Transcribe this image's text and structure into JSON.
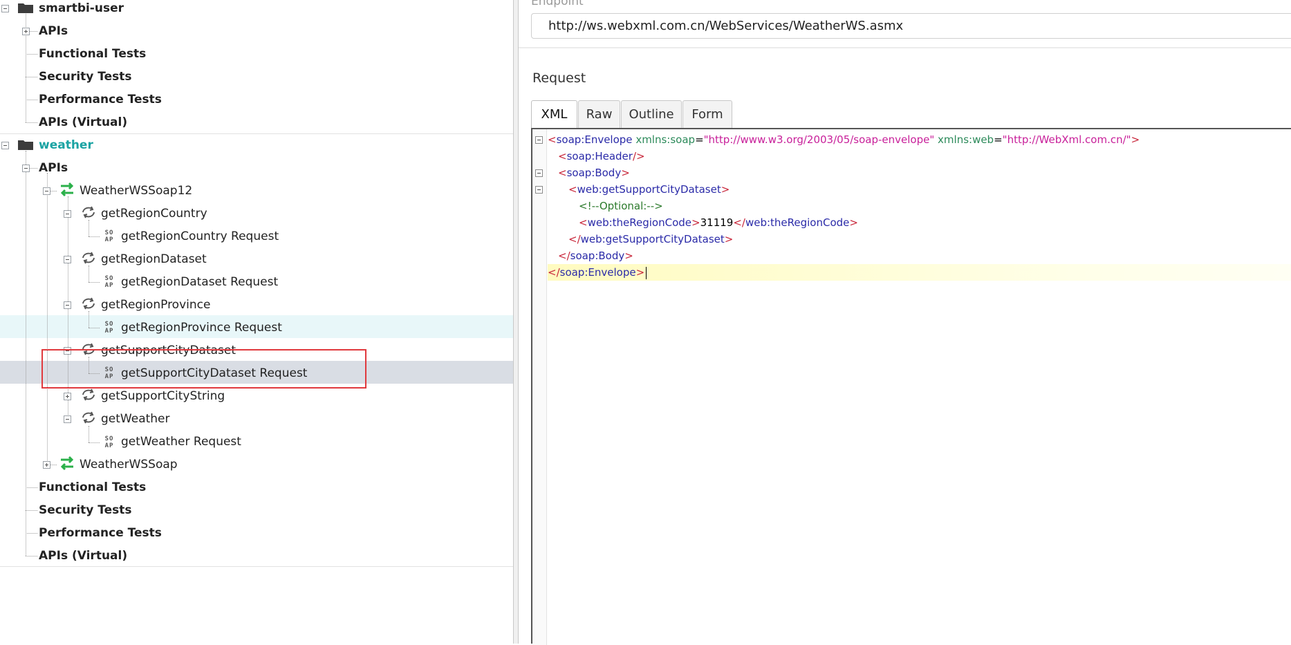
{
  "tree": {
    "projects": [
      {
        "name": "smartbi-user",
        "children": [
          "APIs",
          "Functional Tests",
          "Security Tests",
          "Performance Tests",
          "APIs (Virtual)"
        ]
      },
      {
        "name": "weather",
        "apis_label": "APIs",
        "interfaces": [
          {
            "name": "WeatherWSSoap12",
            "operations": [
              {
                "name": "getRegionCountry",
                "request": "getRegionCountry Request"
              },
              {
                "name": "getRegionDataset",
                "request": "getRegionDataset Request"
              },
              {
                "name": "getRegionProvince",
                "request": "getRegionProvince Request"
              },
              {
                "name": "getSupportCityDataset",
                "request": "getSupportCityDataset Request"
              },
              {
                "name": "getSupportCityString",
                "request": ""
              },
              {
                "name": "getWeather",
                "request": "getWeather Request"
              }
            ]
          },
          {
            "name": "WeatherWSSoap"
          }
        ],
        "children": [
          "Functional Tests",
          "Security Tests",
          "Performance Tests",
          "APIs (Virtual)"
        ]
      }
    ],
    "soap_icon_text": [
      "SO",
      "AP"
    ]
  },
  "endpoint": {
    "label": "Endpoint",
    "value": "http://ws.webxml.com.cn/WebServices/WeatherWS.asmx"
  },
  "request": {
    "title": "Request",
    "tabs": [
      "XML",
      "Raw",
      "Outline",
      "Form"
    ],
    "active_tab": "XML",
    "xml": {
      "envelope_tag": "soap:Envelope",
      "ns_soap_attr": "xmlns:soap",
      "ns_soap_val": "\"http://www.w3.org/2003/05/soap-envelope\"",
      "ns_web_attr": "xmlns:web",
      "ns_web_val": "\"http://WebXml.com.cn/\"",
      "header_tag": "soap:Header",
      "body_tag": "soap:Body",
      "method_tag": "web:getSupportCityDataset",
      "comment": "<!--Optional:-->",
      "param_tag": "web:theRegionCode",
      "param_value": "31119"
    }
  },
  "colors": {
    "selection_outline": "#e0393d",
    "project_active": "#1aa3a3",
    "interface_icon": "#2bb04a",
    "xml_bracket": "#c8263a",
    "xml_tag": "#2a2aa8",
    "xml_attr": "#2c8a5a",
    "xml_value": "#c8209a"
  }
}
